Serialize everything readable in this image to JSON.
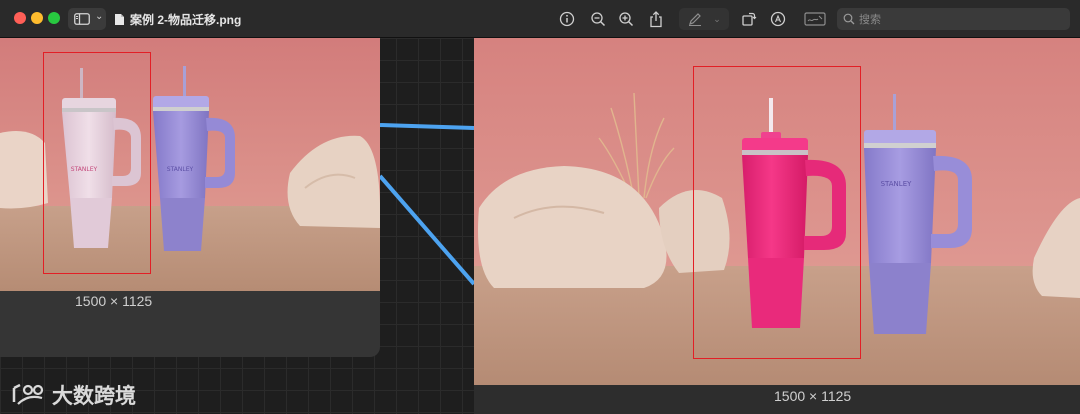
{
  "window": {
    "title": "案例 2-物品迁移.png"
  },
  "toolbar": {
    "search_placeholder": "搜索",
    "buttons": [
      "info-icon",
      "zoom-out-icon",
      "zoom-in-icon",
      "share-icon",
      "markup-pen-icon",
      "markup-menu-chevron-icon",
      "rotate-icon",
      "annotate-icon",
      "signature-icon"
    ]
  },
  "left_image": {
    "caption": "1500 × 1125",
    "brand_pink": "STANLEY",
    "brand_purple": "STANLEY"
  },
  "right_image": {
    "caption": "1500 × 1125",
    "brand_purple": "STANLEY"
  },
  "watermark": {
    "text": "大数跨境"
  },
  "colors": {
    "selection": "#e21f26",
    "connector": "#4da3f0",
    "backdrop": "#d98a86",
    "sand": "#c69a80",
    "tumbler_pink_light": "#ecd7e2",
    "tumbler_lavender": "#9a8ed8",
    "tumbler_hot_pink": "#f0287a"
  }
}
